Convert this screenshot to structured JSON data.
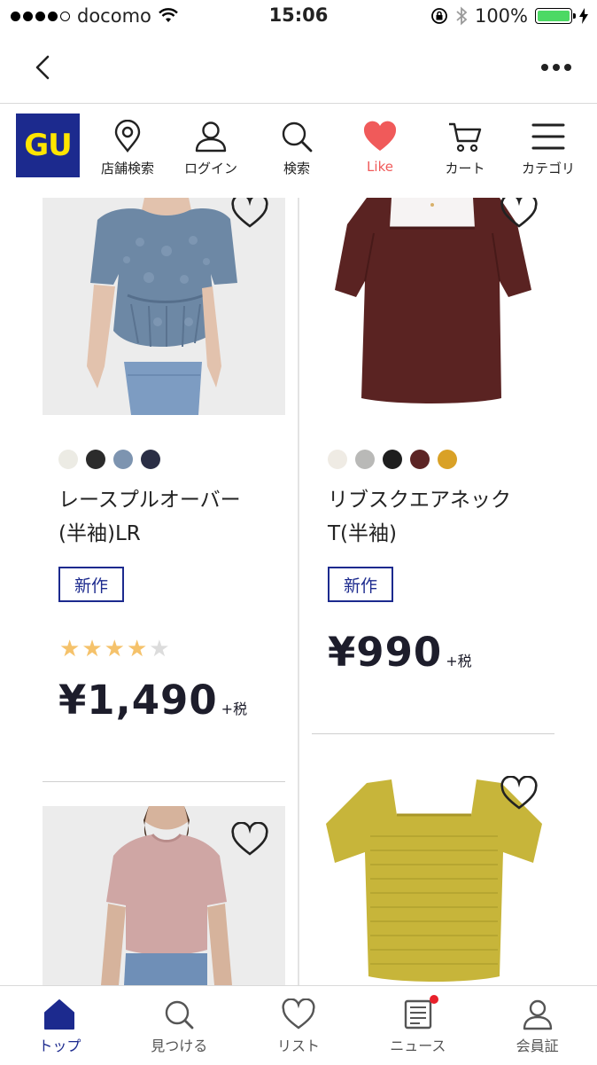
{
  "status_bar": {
    "carrier": "docomo",
    "time": "15:06",
    "battery": "100%",
    "battery_level": 1.0
  },
  "nav": {
    "back_icon": "chevron-left-icon",
    "more_icon": "ellipsis-icon"
  },
  "brand": {
    "logo_text": "GU",
    "logo_bg": "#1c2a8e",
    "logo_fg": "#ffe500"
  },
  "toolbar": {
    "items": [
      {
        "label": "店舗検索",
        "icon": "location-pin-icon"
      },
      {
        "label": "ログイン",
        "icon": "person-icon"
      },
      {
        "label": "検索",
        "icon": "search-icon"
      },
      {
        "label": "Like",
        "icon": "heart-icon",
        "color": "#f05a5a"
      },
      {
        "label": "カート",
        "icon": "cart-icon"
      },
      {
        "label": "カテゴリ",
        "icon": "menu-icon"
      }
    ]
  },
  "products": [
    {
      "name_line1": "レースプルオーバー",
      "name_line2": "(半袖)LR",
      "badge": "新作",
      "rating": 4,
      "rating_max": 5,
      "price": "¥1,490",
      "tax": "+税",
      "colors": [
        "#ecebe4",
        "#2b2b2b",
        "#7d94b0",
        "#2a2e45"
      ]
    },
    {
      "name_line1": "リブスクエアネック",
      "name_line2": "T(半袖)",
      "badge": "新作",
      "price": "¥990",
      "tax": "+税",
      "colors": [
        "#efebe4",
        "#b9b9b7",
        "#1e1e1e",
        "#5c2424",
        "#d9a126"
      ]
    }
  ],
  "tabbar": {
    "items": [
      {
        "label": "トップ",
        "icon": "home-icon",
        "active": true
      },
      {
        "label": "見つける",
        "icon": "search-icon",
        "active": false
      },
      {
        "label": "リスト",
        "icon": "heart-icon",
        "active": false
      },
      {
        "label": "ニュース",
        "icon": "news-icon",
        "active": false,
        "notification": true
      },
      {
        "label": "会員証",
        "icon": "member-card-icon",
        "active": false
      }
    ],
    "active_color": "#1c2a8e"
  }
}
